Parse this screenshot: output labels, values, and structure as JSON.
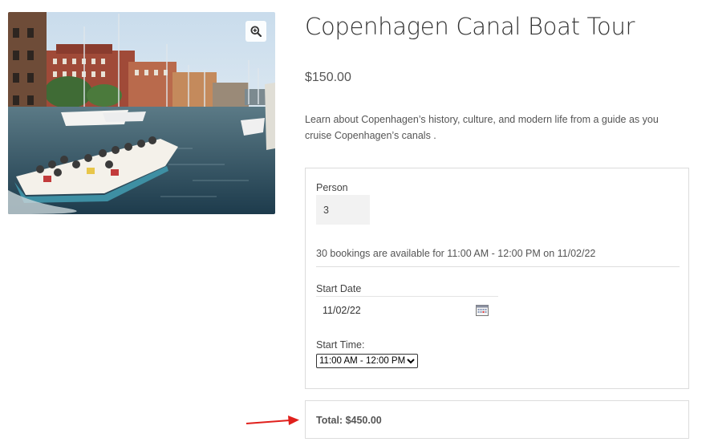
{
  "product": {
    "title": "Copenhagen Canal Boat Tour",
    "price": "$150.00",
    "description": "Learn about Copenhagen’s history, culture, and modern life from a guide as you cruise Copenhagen’s canals ."
  },
  "gallery": {
    "zoom_icon": "magnifier-plus-icon"
  },
  "booking": {
    "person_label": "Person",
    "person_value": "3",
    "availability": "30 bookings are available for 11:00 AM - 12:00 PM on 11/02/22",
    "start_date_label": "Start Date",
    "start_date_value": "11/02/22",
    "calendar_icon": "calendar-icon",
    "start_time_label": "Start Time:",
    "start_time_selected": "11:00 AM - 12:00 PM"
  },
  "total": {
    "text": "Total: $450.00"
  },
  "annotation": {
    "arrow_color": "#e0201c"
  }
}
